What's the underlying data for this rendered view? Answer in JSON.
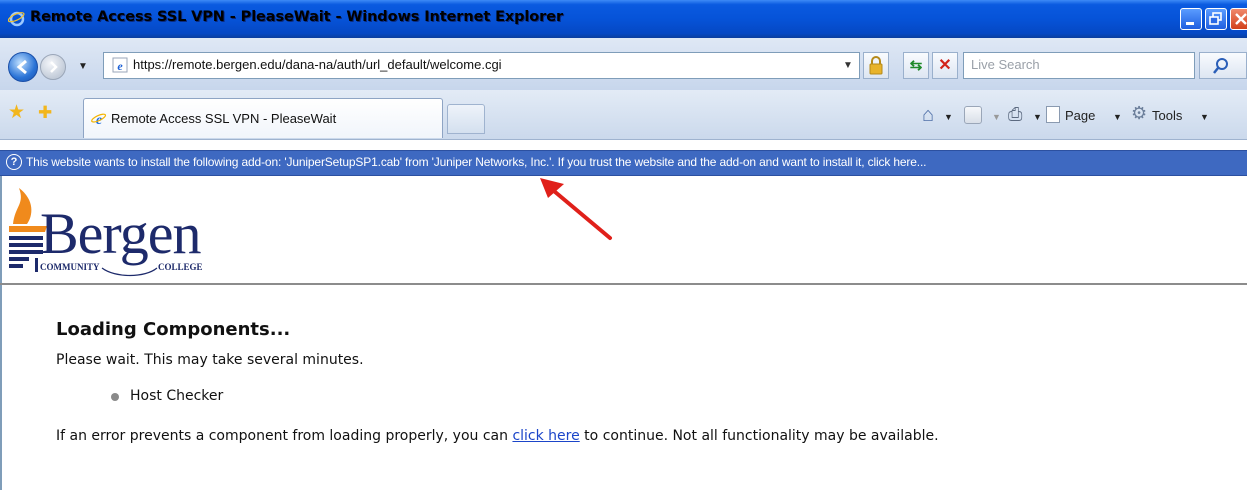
{
  "window": {
    "title": "Remote Access SSL VPN - PleaseWait - Windows Internet Explorer"
  },
  "address_bar": {
    "url": "https://remote.bergen.edu/dana-na/auth/url_default/welcome.cgi",
    "search_placeholder": "Live Search"
  },
  "tabs": [
    {
      "label": "Remote Access SSL VPN - PleaseWait",
      "active": true
    }
  ],
  "command_bar": {
    "page_label": "Page",
    "tools_label": "Tools"
  },
  "info_bar": {
    "text": "This website wants to install the following add-on: 'JuniperSetupSP1.cab' from 'Juniper Networks, Inc.'. If you trust the website and the add-on and want to install it, click here..."
  },
  "logo": {
    "wordmark": "Bergen",
    "sub_left": "COMMUNITY",
    "sub_right": "COLLEGE"
  },
  "content": {
    "heading": "Loading Components...",
    "wait_text": "Please wait. This may take several minutes.",
    "components": [
      "Host Checker"
    ],
    "error_prefix": "If an error prevents a component from loading properly, you can ",
    "error_link": "click here",
    "error_suffix": " to continue. Not all functionality may be available."
  },
  "colors": {
    "title_bar": "#0653d8",
    "info_bar": "#3e69c1",
    "link": "#1b45c9",
    "logo_navy": "#1d2a6b",
    "logo_orange": "#f08a1c",
    "annotation_arrow": "#e0201a"
  },
  "icons": [
    "ie-logo-icon",
    "minimize-icon",
    "maximize-icon",
    "close-icon",
    "back-icon",
    "forward-icon",
    "lock-icon",
    "refresh-icon",
    "stop-icon",
    "search-icon",
    "favorites-star-icon",
    "add-favorites-icon",
    "home-icon",
    "feeds-icon",
    "print-icon",
    "page-icon",
    "tools-gear-icon",
    "info-icon",
    "red-arrow-annotation"
  ]
}
